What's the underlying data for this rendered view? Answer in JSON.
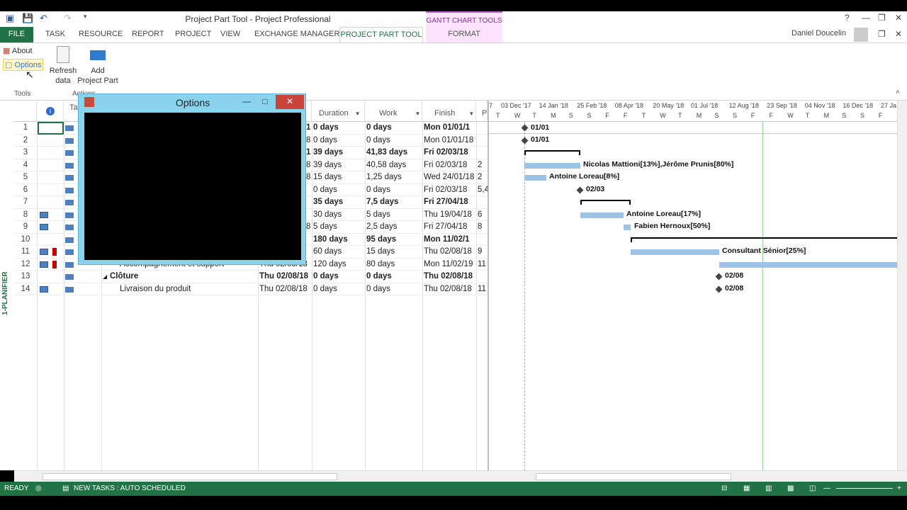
{
  "window": {
    "title": "Project Part Tool - Project Professional",
    "gantt_tools_label": "GANTT CHART TOOLS",
    "user": "Daniel Doucelin",
    "help": "?"
  },
  "tabs": {
    "file": "FILE",
    "items": [
      "TASK",
      "RESOURCE",
      "REPORT",
      "PROJECT",
      "VIEW",
      "EXCHANGE MANAGER"
    ],
    "active": "PROJECT PART TOOL",
    "format": "FORMAT"
  },
  "ribbon": {
    "about": "About",
    "options": "Options",
    "refresh_line1": "Refresh",
    "refresh_line2": "data",
    "add_line1": "Add",
    "add_line2": "Project Part",
    "tools_label": "Tools",
    "actions_label": "Actions"
  },
  "sheet": {
    "vertical_label": "1-PLANIFIER",
    "headers": {
      "task_mode": "Ta Mo",
      "duration": "Duration",
      "work": "Work",
      "finish": "Finish",
      "predecessors": "P"
    },
    "rows": [
      {
        "id": "1",
        "bold": true,
        "name": "",
        "start": "",
        "cut": "1",
        "duration": "0 days",
        "work": "0 days",
        "finish": "Mon 01/01/1",
        "pred": "",
        "indicator": false,
        "person": false
      },
      {
        "id": "2",
        "bold": false,
        "name": "",
        "start": "",
        "cut": "8",
        "duration": "0 days",
        "work": "0 days",
        "finish": "Mon 01/01/18",
        "pred": "",
        "indicator": false,
        "person": false
      },
      {
        "id": "3",
        "bold": true,
        "name": "",
        "start": "",
        "cut": "1",
        "duration": "39 days",
        "work": "41,83 days",
        "finish": "Fri 02/03/18",
        "pred": "",
        "indicator": false,
        "person": false
      },
      {
        "id": "4",
        "bold": false,
        "name": "",
        "start": "",
        "cut": "8",
        "duration": "39 days",
        "work": "40,58 days",
        "finish": "Fri 02/03/18",
        "pred": "2",
        "indicator": false,
        "person": false
      },
      {
        "id": "5",
        "bold": false,
        "name": "",
        "start": "",
        "cut": "8",
        "duration": "15 days",
        "work": "1,25 days",
        "finish": "Wed 24/01/18",
        "pred": "2",
        "indicator": false,
        "person": false
      },
      {
        "id": "6",
        "bold": false,
        "name": "",
        "start": "",
        "cut": "",
        "duration": "0 days",
        "work": "0 days",
        "finish": "Fri 02/03/18",
        "pred": "5,4",
        "indicator": false,
        "person": false
      },
      {
        "id": "7",
        "bold": true,
        "name": "",
        "start": "",
        "cut": "",
        "duration": "35 days",
        "work": "7,5 days",
        "finish": "Fri 27/04/18",
        "pred": "",
        "indicator": false,
        "person": false
      },
      {
        "id": "8",
        "bold": false,
        "name": "",
        "start": "",
        "cut": "",
        "duration": "30 days",
        "work": "5 days",
        "finish": "Thu 19/04/18",
        "pred": "6",
        "indicator": true,
        "person": false
      },
      {
        "id": "9",
        "bold": false,
        "name": "",
        "start": "",
        "cut": "8",
        "duration": "5 days",
        "work": "2,5 days",
        "finish": "Fri 27/04/18",
        "pred": "8",
        "indicator": true,
        "person": false
      },
      {
        "id": "10",
        "bold": true,
        "name": "",
        "start": "",
        "cut": "",
        "duration": "180 days",
        "work": "95 days",
        "finish": "Mon 11/02/1",
        "pred": "",
        "indicator": false,
        "person": false
      },
      {
        "id": "11",
        "bold": false,
        "name": "",
        "start": "",
        "cut": "",
        "duration": "60 days",
        "work": "15 days",
        "finish": "Thu 02/08/18",
        "pred": "9",
        "indicator": true,
        "person": true
      },
      {
        "id": "12",
        "bold": false,
        "name": "Accompagnement et support",
        "start": "Thu 02/08/18",
        "cut": "",
        "duration": "120 days",
        "work": "80 days",
        "finish": "Mon 11/02/19",
        "pred": "11",
        "indicator": true,
        "person": true
      },
      {
        "id": "13",
        "bold": true,
        "name": "Clôture",
        "start": "Thu 02/08/18",
        "cut": "",
        "duration": "0 days",
        "work": "0 days",
        "finish": "Thu 02/08/18",
        "pred": "",
        "indicator": false,
        "person": false
      },
      {
        "id": "14",
        "bold": false,
        "name": "Livraison du produit",
        "start": "Thu 02/08/18",
        "cut": "",
        "duration": "0 days",
        "work": "0 days",
        "finish": "Thu 02/08/18",
        "pred": "11",
        "indicator": true,
        "person": false
      }
    ]
  },
  "gantt": {
    "timescale_top": [
      "7",
      "03 Dec '17",
      "14 Jan '18",
      "25 Feb '18",
      "08 Apr '18",
      "20 May '18",
      "01 Jul '18",
      "12 Aug '18",
      "23 Sep '18",
      "04 Nov '18",
      "16 Dec '18",
      "27 Ja"
    ],
    "timescale_bottom": [
      "T",
      "W",
      "T",
      "M",
      "S",
      "S",
      "F",
      "F",
      "T",
      "W",
      "T",
      "M",
      "S",
      "S",
      "F",
      "F",
      "W",
      "T",
      "M",
      "S",
      "S",
      "F",
      "T"
    ],
    "labels": {
      "m1": "01/01",
      "m2": "01/01",
      "r4": "Nicolas Mattioni[13%],Jérôme Prunis[80%]",
      "r5": "Antoine Loreau[8%]",
      "m6": "02/03",
      "r8": "Antoine Loreau[17%]",
      "r9": "Fabien Hernoux[50%]",
      "r11": "Consultant Sénior[25%]",
      "m13": "02/08",
      "m14": "02/08"
    }
  },
  "dialog": {
    "title": "Options",
    "minimize": "—",
    "maximize": "□",
    "close": "✕"
  },
  "status": {
    "ready": "READY",
    "new_tasks": "NEW TASKS : AUTO SCHEDULED"
  }
}
